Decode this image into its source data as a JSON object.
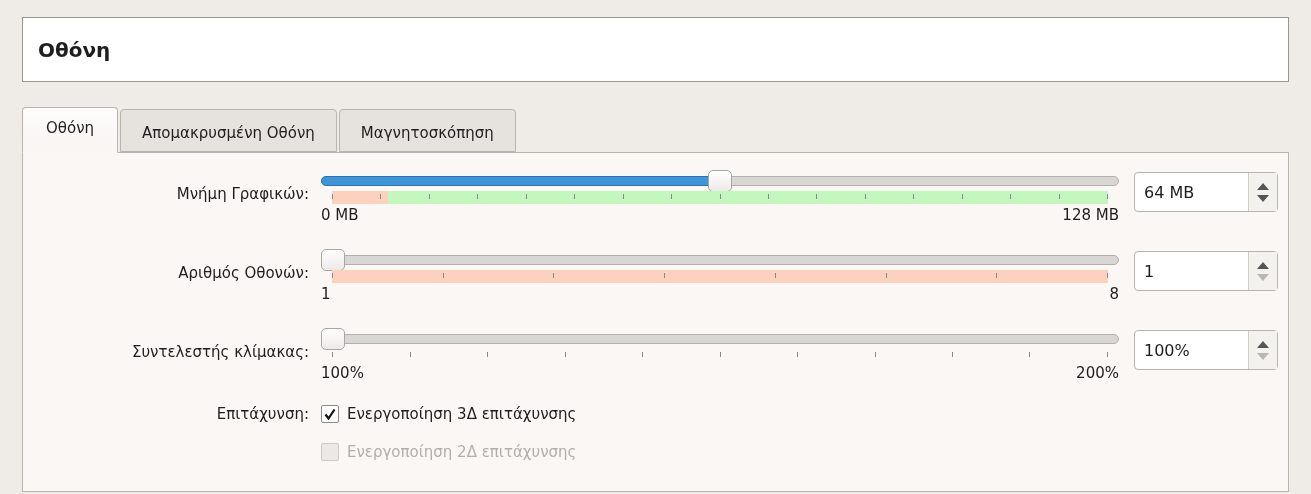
{
  "title": "Οθόνη",
  "tabs": [
    {
      "label": "Οθόνη",
      "selected": true
    },
    {
      "label": "Απομακρυσμένη Οθόνη",
      "selected": false
    },
    {
      "label": "Μαγνητοσκόπηση",
      "selected": false
    }
  ],
  "settings": [
    {
      "label": "Μνήμη Γραφικών:",
      "kind": "memory",
      "level": 0.5,
      "min_label": "0 MB",
      "max_label": "128 MB",
      "value": "64 MB",
      "up_disabled": false,
      "down_disabled": false,
      "segments": [
        {
          "color": "#fcd1bd",
          "level": 0.072
        },
        {
          "color": "#c3f7bd",
          "level": 0.928
        }
      ]
    },
    {
      "label": "Αριθμός Οθονών:",
      "kind": "count",
      "level": 0,
      "min_label": "1",
      "max_label": "8",
      "value": "1",
      "up_disabled": false,
      "down_disabled": true,
      "segments": [
        {
          "color": "#fcd1bd",
          "level": 1
        }
      ]
    },
    {
      "label": "Συντελεστής κλίμακας:",
      "kind": "percent",
      "level": 0,
      "min_label": "100%",
      "max_label": "200%",
      "value": "100%",
      "up_disabled": false,
      "down_disabled": true
    }
  ],
  "acceleration": {
    "label": "Επιτάχυνση:",
    "options": [
      {
        "label": "Ενεργοποίηση 3Δ επιτάχυνσης",
        "checked": true,
        "disabled": false
      },
      {
        "label": "Ενεργοποίηση 2Δ επιτάχυνσης",
        "checked": false,
        "disabled": true
      }
    ]
  }
}
